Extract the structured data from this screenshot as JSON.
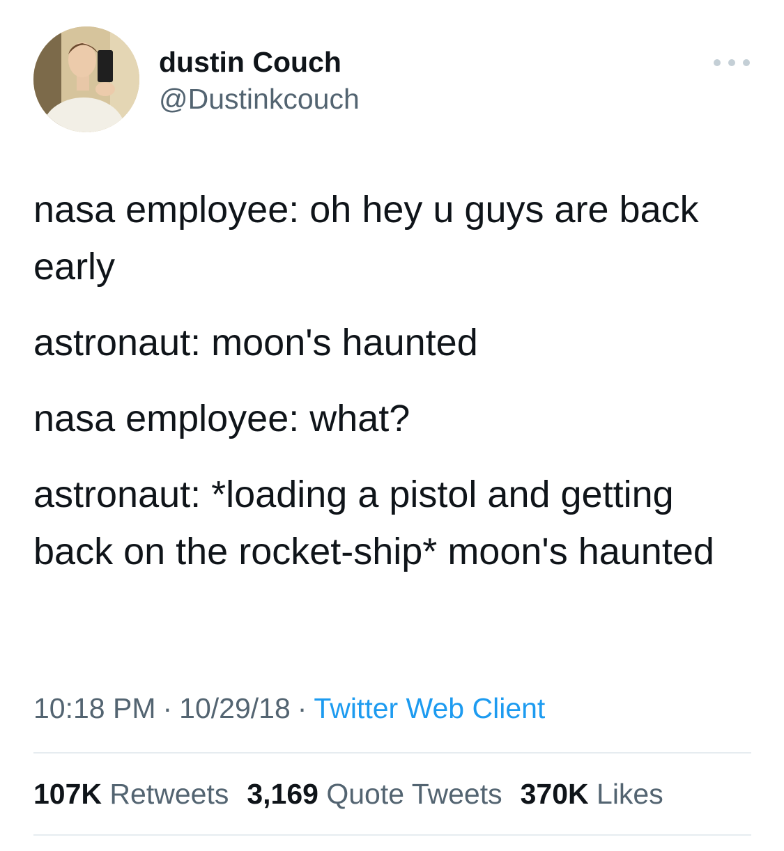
{
  "author": {
    "display_name": "dustin Couch",
    "handle": "@Dustinkcouch"
  },
  "more_icon": "more-horizontal-icon",
  "tweet": {
    "paragraphs": [
      "nasa employee: oh hey u guys are back early",
      "astronaut: moon's haunted",
      "nasa employee: what?",
      "astronaut: *loading a pistol and getting back on the rocket-ship* moon's haunted"
    ]
  },
  "meta": {
    "time": "10:18 PM",
    "separator": "·",
    "date": "10/29/18",
    "source": "Twitter Web Client"
  },
  "stats": {
    "retweets": {
      "count": "107K",
      "label": "Retweets"
    },
    "quote_tweets": {
      "count": "3,169",
      "label": "Quote Tweets"
    },
    "likes": {
      "count": "370K",
      "label": "Likes"
    }
  },
  "colors": {
    "text": "#0f1419",
    "secondary": "#536471",
    "link": "#1d9bf0",
    "divider": "#e6ecf0"
  }
}
